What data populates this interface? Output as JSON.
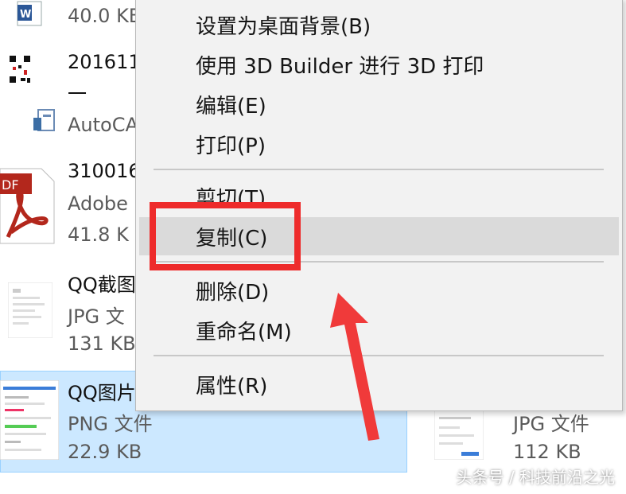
{
  "files": [
    {
      "name": "",
      "type": "",
      "size": "40.0 KB",
      "icon": "word-doc-icon"
    },
    {
      "name": "201611",
      "type": "一",
      "size": "",
      "icon": "qr-code-icon"
    },
    {
      "name": "AutoCA",
      "type": "",
      "size": "",
      "icon": "autocad-icon"
    },
    {
      "name": "310016",
      "type": "Adobe",
      "size": "41.8 K",
      "icon": "pdf-icon"
    },
    {
      "name": "QQ截图",
      "type": "JPG 文",
      "size": "131 KB",
      "icon": "jpg-thumbnail-icon"
    },
    {
      "name": "QQ图片",
      "type": "PNG 文件",
      "size": "22.9 KB",
      "icon": "png-thumbnail-icon"
    },
    {
      "name": "",
      "type": "JPG 文件",
      "size": "112 KB",
      "icon": "jpg-thumbnail-icon"
    }
  ],
  "context_menu": {
    "items": [
      {
        "label": "设置为桌面背景(B)"
      },
      {
        "label": "使用 3D Builder 进行 3D 打印"
      },
      {
        "label": "编辑(E)"
      },
      {
        "label": "打印(P)"
      },
      {
        "label": "剪切(T)"
      },
      {
        "label": "复制(C)",
        "highlighted": true
      },
      {
        "label": "删除(D)"
      },
      {
        "label": "重命名(M)"
      },
      {
        "label": "属性(R)"
      }
    ]
  },
  "annotation": {
    "box_color": "#ee2b2b",
    "arrow_color": "#f03a3a"
  },
  "watermark": "头条号 / 科技前沿之光"
}
